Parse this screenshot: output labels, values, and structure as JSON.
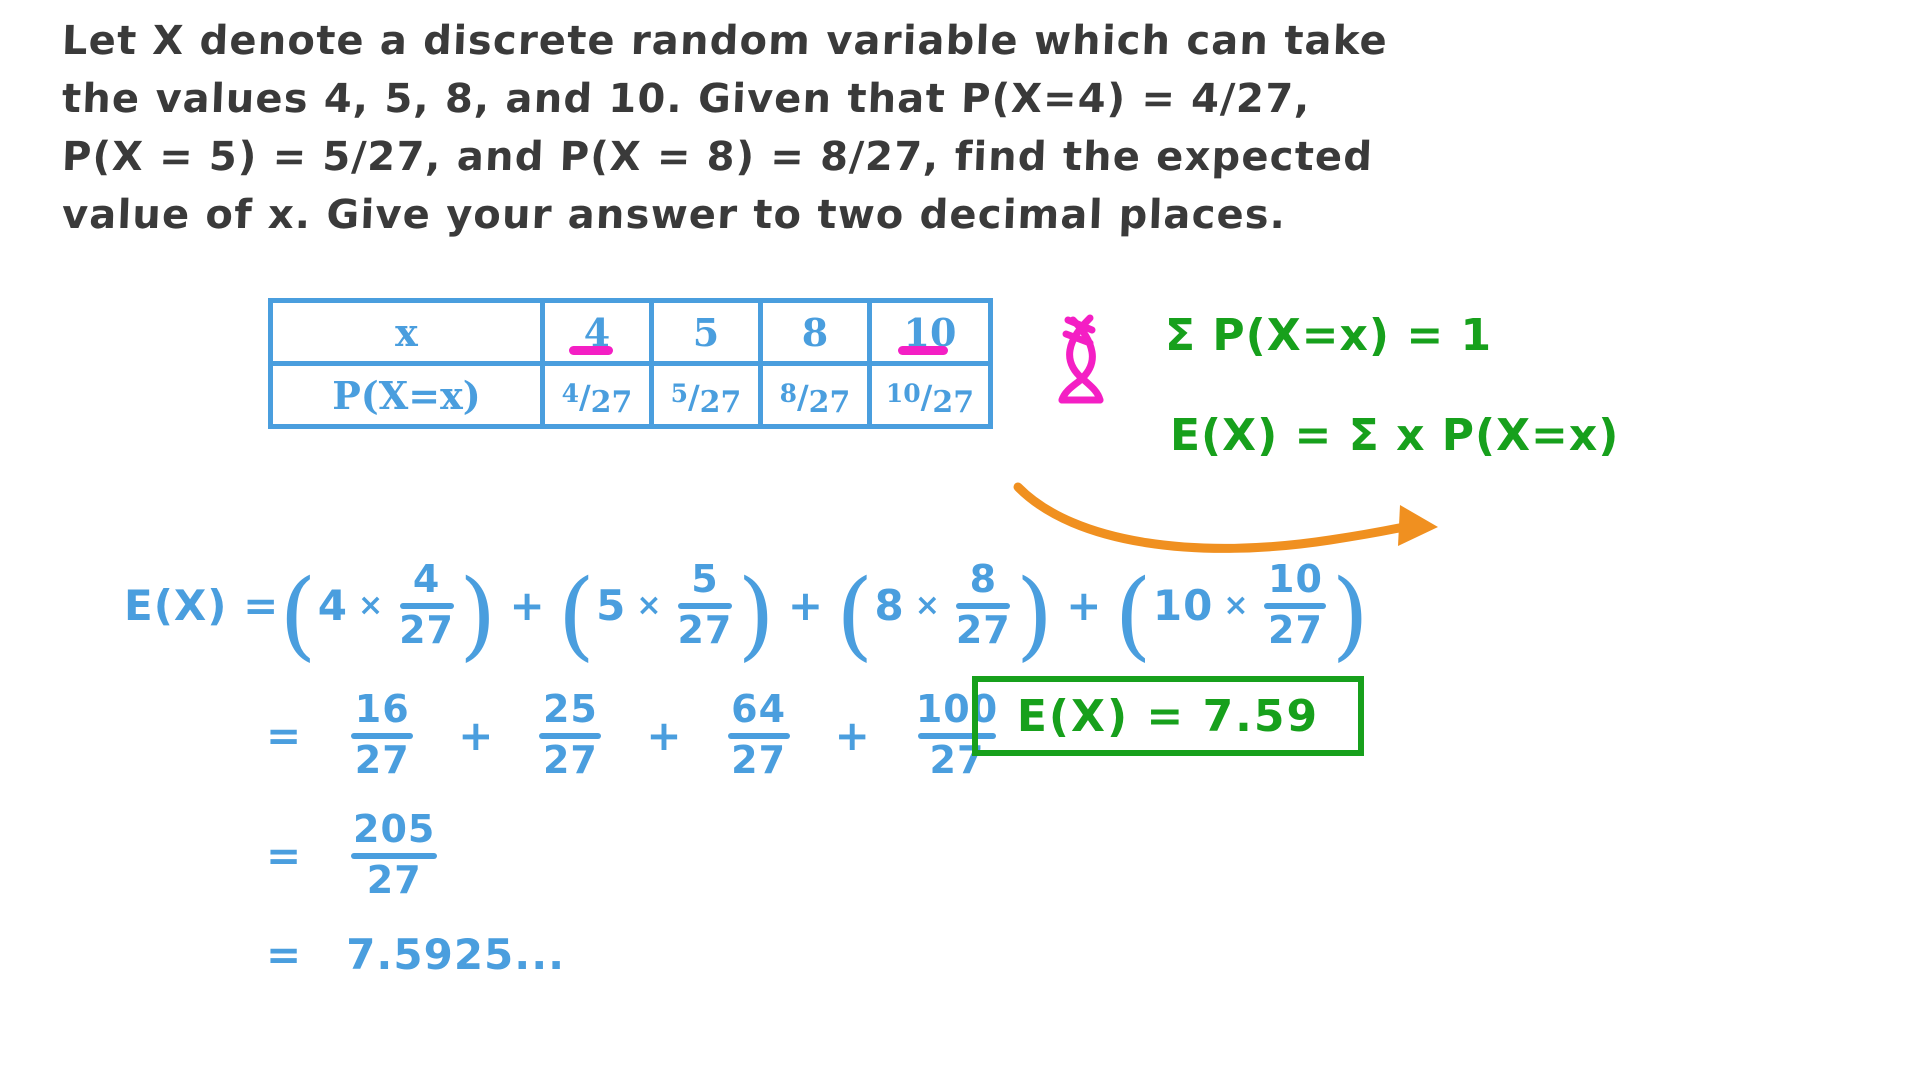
{
  "document": {
    "type": "handwritten-math-solution",
    "topic": "Expected value of a discrete random variable"
  },
  "colors": {
    "problem_ink": "#3a3a3a",
    "working_ink": "#4a9ede",
    "annotation_ink": "#17a01c",
    "highlight_ink": "#f41fc4",
    "arrow_ink": "#f09020",
    "background": "#ffffff"
  },
  "problem": {
    "line1": "Let X denote a discrete random variable which can take",
    "line2": "the values 4, 5, 8, and 10. Given that P(X=4) = 4/27,",
    "line3": "P(X = 5) = 5/27, and P(X = 8) = 8/27, find the expected",
    "line4": "value of x. Give your answer to two decimal places."
  },
  "table": {
    "row_labels": [
      "x",
      "P(X=x)"
    ],
    "x_values": [
      "4",
      "5",
      "8",
      "10"
    ],
    "probabilities": [
      {
        "numerator": "4",
        "denominator": "27"
      },
      {
        "numerator": "5",
        "denominator": "27"
      },
      {
        "numerator": "8",
        "denominator": "27"
      },
      {
        "numerator": "10",
        "denominator": "27"
      }
    ],
    "highlighted_cells": [
      "4",
      "10"
    ]
  },
  "annotations": {
    "rule_sum": "Σ P(X=x) = 1",
    "rule_expectation": "E(X) = Σ x P(X=x)",
    "bracket_symbol": "magenta-bracket",
    "arrow_symbol": "orange-curved-arrow"
  },
  "working": {
    "line1_lhs": "E(X) =",
    "line1_terms": [
      {
        "coefficient": "4",
        "times": "×",
        "numerator": "4",
        "denominator": "27"
      },
      {
        "coefficient": "5",
        "times": "×",
        "numerator": "5",
        "denominator": "27"
      },
      {
        "coefficient": "8",
        "times": "×",
        "numerator": "8",
        "denominator": "27"
      },
      {
        "coefficient": "10",
        "times": "×",
        "numerator": "10",
        "denominator": "27"
      }
    ],
    "plus": "+",
    "line2_eq": "=",
    "line2_terms": [
      {
        "numerator": "16",
        "denominator": "27"
      },
      {
        "numerator": "25",
        "denominator": "27"
      },
      {
        "numerator": "64",
        "denominator": "27"
      },
      {
        "numerator": "100",
        "denominator": "27"
      }
    ],
    "line3_eq": "=",
    "line3_fraction": {
      "numerator": "205",
      "denominator": "27"
    },
    "line4_eq": "=",
    "line4_value": "7.5925..."
  },
  "answer": {
    "label": "E(X) =",
    "value": "7.59",
    "full": "E(X) = 7.59"
  }
}
